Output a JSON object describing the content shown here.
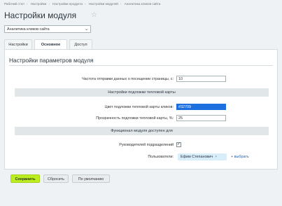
{
  "breadcrumbs": [
    "Рабочий стол",
    "Настройки",
    "Настройки продукта",
    "Настройки модулей",
    "Аналитика кликов сайта"
  ],
  "page_title": "Настройки модуля",
  "module_select": {
    "value": "Аналитика кликов сайта"
  },
  "tabs": [
    {
      "label": "Настройки"
    },
    {
      "label": "Основное"
    },
    {
      "label": "Доступ"
    }
  ],
  "panel": {
    "title": "Настройки параметров модуля",
    "frequency": {
      "label": "Частота отправки данных о посещении страницы, с:",
      "value": "10"
    },
    "heatmap_section": "Настройки подложки тепловой карты",
    "color": {
      "label": "Цвет подложки тепловой карты кликов:",
      "value": "#32709"
    },
    "opacity": {
      "label": "Прозрачность подложки тепловой карты, %:",
      "value": "25"
    },
    "access_section": "Функционал модуля доступен для",
    "heads": {
      "label": "Руководителей подразделений",
      "checked": "✓"
    },
    "users": {
      "label": "Пользователи:",
      "chip": "Ефим Степанович",
      "chip_close": "×",
      "add_label": "+ выбрать"
    }
  },
  "buttons": {
    "save": "Сохранить",
    "reset": "Сбросить",
    "defaults": "По умолчанию"
  },
  "colors": {
    "accent": "#bbed21",
    "selection": "#1d6fdf",
    "section_bg": "#e1e6e9"
  }
}
